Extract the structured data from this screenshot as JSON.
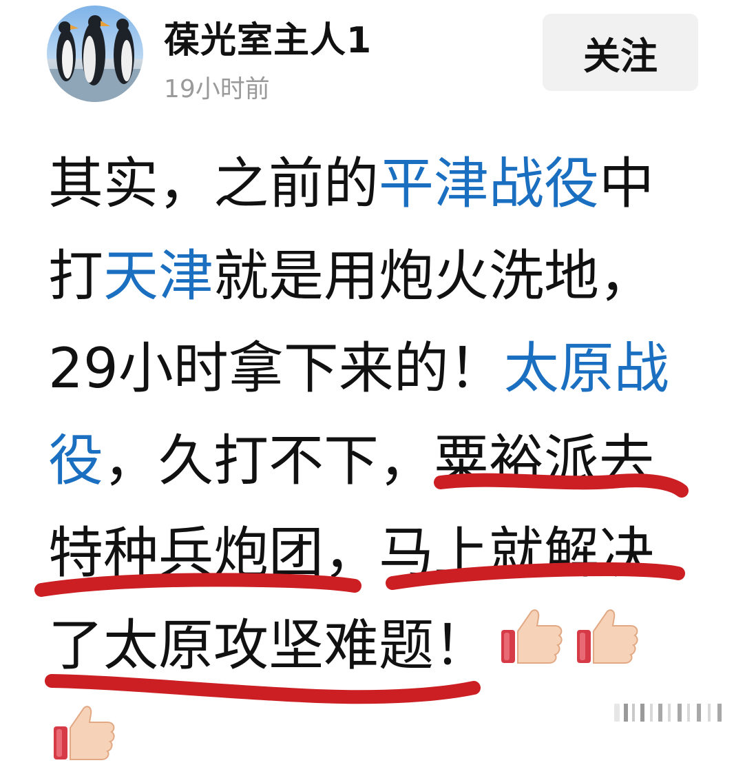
{
  "author": {
    "name": "葆光室主人1",
    "time": "19小时前"
  },
  "actions": {
    "follow_label": "关注"
  },
  "post": {
    "line1": {
      "a": "其实，之前的",
      "link": "平津战役",
      "b": "中"
    },
    "line2": {
      "a": "打",
      "link": "天津",
      "b": "就是用炮火洗地，"
    },
    "line3": {
      "a": "29小时拿下来的！",
      "link": "太原战"
    },
    "line4": {
      "link": "役",
      "a": "，久打不下，",
      "b": "粟裕派去"
    },
    "line5": {
      "a": "特种兵炮团，马上就解决"
    },
    "line6": {
      "a": "了太原攻坚难题！"
    }
  },
  "emojis": [
    "thumbs-up-icon",
    "thumbs-up-icon",
    "thumbs-up-icon"
  ],
  "colors": {
    "link": "#1b6fc1",
    "underline": "#cc1f24",
    "text": "#111111",
    "meta": "#9a9a9a",
    "follow_bg": "#f1f1f1"
  }
}
